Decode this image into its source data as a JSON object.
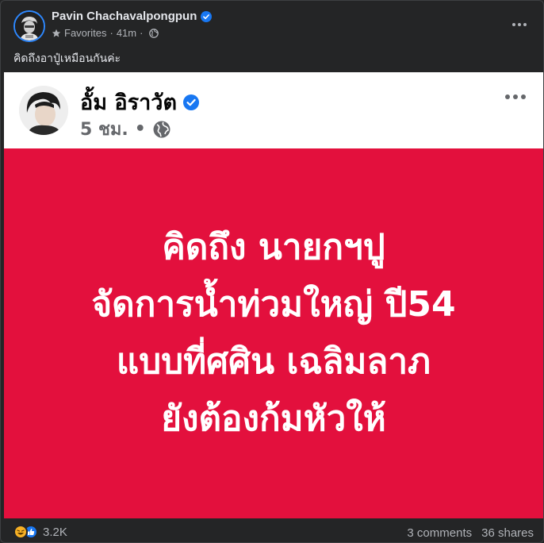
{
  "post": {
    "author": "Pavin Chachavalpongpun",
    "audience": "Favorites",
    "time": "41m",
    "separator": "·",
    "caption": "คิดถึงอาปู๋เหมือนกันค่ะ"
  },
  "shared": {
    "author": "อั้ม อิราวัต",
    "time": "5 ชม.",
    "separator": "•",
    "lines": [
      "คิดถึง นายกฯปู",
      "จัดการน้ำท่วมใหญ่ ปี54",
      "แบบที่ศศิน เฉลิมลาภ",
      "ยังต้องก้มหัวให้"
    ],
    "bg_color": "#e3103d"
  },
  "footer": {
    "reactions_count": "3.2K",
    "comments": "3 comments",
    "shares": "36 shares"
  },
  "colors": {
    "background": "#242526",
    "accent": "#2d88ff",
    "verified": "#1877f2"
  },
  "icons": {
    "author_verified": "verified-badge-icon",
    "audience": "star-icon",
    "privacy": "globe-icon",
    "more": "more-options-icon",
    "reaction_haha": "haha-reaction-icon",
    "reaction_like": "like-reaction-icon"
  }
}
